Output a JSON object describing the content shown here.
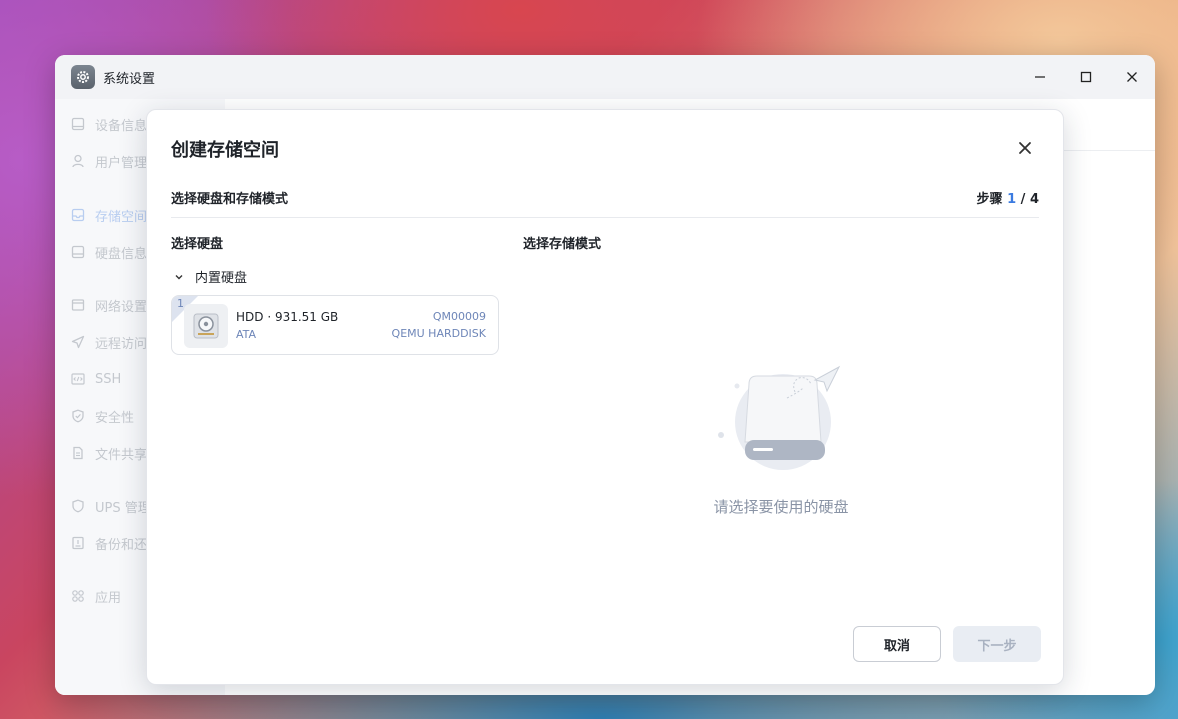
{
  "window": {
    "title": "系统设置",
    "icon": "gear-icon"
  },
  "sidebar": {
    "items": [
      {
        "label": "设备信息",
        "icon": "device-icon"
      },
      {
        "label": "用户管理",
        "icon": "user-icon"
      },
      {
        "label": "存储空间",
        "icon": "storage-icon",
        "active": true
      },
      {
        "label": "硬盘信息",
        "icon": "disk-icon"
      },
      {
        "label": "网络设置",
        "icon": "network-icon"
      },
      {
        "label": "远程访问",
        "icon": "send-icon"
      },
      {
        "label": "SSH",
        "icon": "code-icon"
      },
      {
        "label": "安全性",
        "icon": "shield-icon"
      },
      {
        "label": "文件共享",
        "icon": "file-icon"
      },
      {
        "label": "UPS 管理",
        "icon": "ups-icon"
      },
      {
        "label": "备份和还原",
        "icon": "backup-icon"
      },
      {
        "label": "应用",
        "icon": "apps-icon"
      }
    ]
  },
  "dialog": {
    "title": "创建存储空间",
    "subtitle": "选择硬盘和存储模式",
    "step_label": "步骤",
    "step_current": "1",
    "step_sep": " / ",
    "step_total": "4",
    "left_title": "选择硬盘",
    "right_title": "选择存储模式",
    "group_label": "内置硬盘",
    "disk": {
      "slot": "1",
      "name": "HDD · 931.51 GB",
      "interface": "ATA",
      "serial": "QM00009",
      "model": "QEMU HARDDISK"
    },
    "empty_text": "请选择要使用的硬盘",
    "cancel_label": "取消",
    "next_label": "下一步"
  },
  "colors": {
    "accent": "#3b7be0",
    "muted_blue": "#6e86b8"
  }
}
